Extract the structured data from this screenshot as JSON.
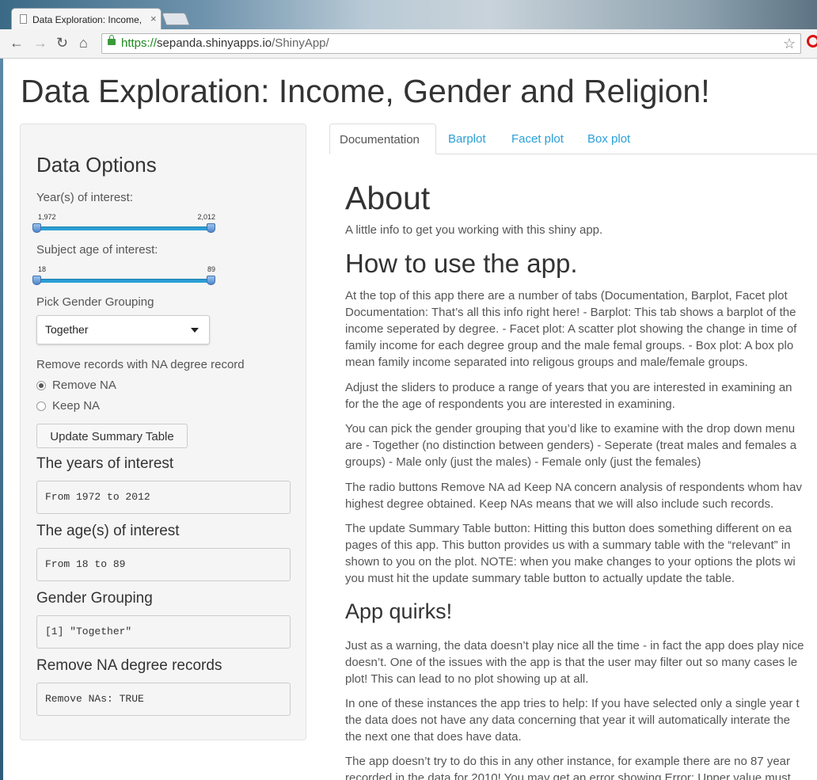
{
  "browser": {
    "tab_title": "Data Exploration: Income,",
    "tab_close": "×",
    "url_secure": "https://",
    "url_host": "sepanda.shinyapps.io",
    "url_path": "/ShinyApp/",
    "nav": {
      "back": "←",
      "forward": "→",
      "reload": "↻",
      "home": "⌂",
      "star": "☆"
    }
  },
  "page": {
    "title": "Data Exploration: Income, Gender and Religion!"
  },
  "sidebar": {
    "heading": "Data Options",
    "years_label": "Year(s) of interest:",
    "years_slider": {
      "min_label": "1,972",
      "max_label": "2,012",
      "low_fraction": 0.0,
      "high_fraction": 1.0
    },
    "age_label": "Subject age of interest:",
    "age_slider": {
      "min_label": "18",
      "max_label": "89",
      "low_fraction": 0.0,
      "high_fraction": 1.0
    },
    "gender_label": "Pick Gender Grouping",
    "gender_selected": "Together",
    "na_label": "Remove records with NA degree record",
    "radio_remove": "Remove NA",
    "radio_keep": "Keep NA",
    "radio_selected": "Remove NA",
    "update_button": "Update Summary Table",
    "out_years_heading": "The years of interest",
    "out_years_value": "From 1972 to 2012",
    "out_age_heading": "The age(s) of interest",
    "out_age_value": "From 18 to 89",
    "out_gender_heading": "Gender Grouping",
    "out_gender_value": "[1] \"Together\"",
    "out_na_heading": "Remove NA degree records",
    "out_na_value": "Remove NAs: TRUE"
  },
  "tabs": [
    {
      "label": "Documentation",
      "active": true
    },
    {
      "label": "Barplot",
      "active": false
    },
    {
      "label": "Facet plot",
      "active": false
    },
    {
      "label": "Box plot",
      "active": false
    }
  ],
  "doc": {
    "about_heading": "About",
    "about_text": "A little info to get you working with this shiny app.",
    "how_heading": "How to use the app.",
    "how_p1": [
      "At the top of this app there are a number of tabs (Documentation, Barplot, Facet plot",
      "Documentation: That’s all this info right here! - Barplot: This tab shows a barplot of the",
      "income seperated by degree. - Facet plot: A scatter plot showing the change in time of",
      "family income for each degree group and the male femal groups. - Box plot: A box plo",
      "mean family income separated into religous groups and male/female groups."
    ],
    "how_p2": [
      "Adjust the sliders to produce a range of years that you are interested in examining an",
      "for the the age of respondents you are interested in examining."
    ],
    "how_p3": [
      "You can pick the gender grouping that you’d like to examine with the drop down menu",
      "are - Together (no distinction between genders) - Seperate (treat males and females a",
      "groups) - Male only (just the males) - Female only (just the females)"
    ],
    "how_p4": [
      "The radio buttons Remove NA ad Keep NA concern analysis of respondents whom hav",
      "highest degree obtained. Keep NAs means that we will also include such records."
    ],
    "how_p5": [
      "The update Summary Table button: Hitting this button does something different on ea",
      "pages of this app. This button provides us with a summary table with the “relevant” in",
      "shown to you on the plot. NOTE: when you make changes to your options the plots wi",
      "you must hit the update summary table button to actually update the table."
    ],
    "quirks_heading": "App quirks!",
    "quirks_p1": [
      "Just as a warning, the data doesn’t play nice all the time - in fact the app does play nice",
      "doesn’t. One of the issues with the app is that the user may filter out so many cases le",
      "plot! This can lead to no plot showing up at all."
    ],
    "quirks_p2": [
      "In one of these instances the app tries to help: If you have selected only a single year t",
      "the data does not have any data concerning that year it will automatically interate the",
      "the next one that does have data."
    ],
    "quirks_p3": [
      "The app doesn’t try to do this in any other instance, for example there are no 87 year",
      "recorded in the data for 2010! You may get an error showing Error: Upper value must"
    ]
  }
}
